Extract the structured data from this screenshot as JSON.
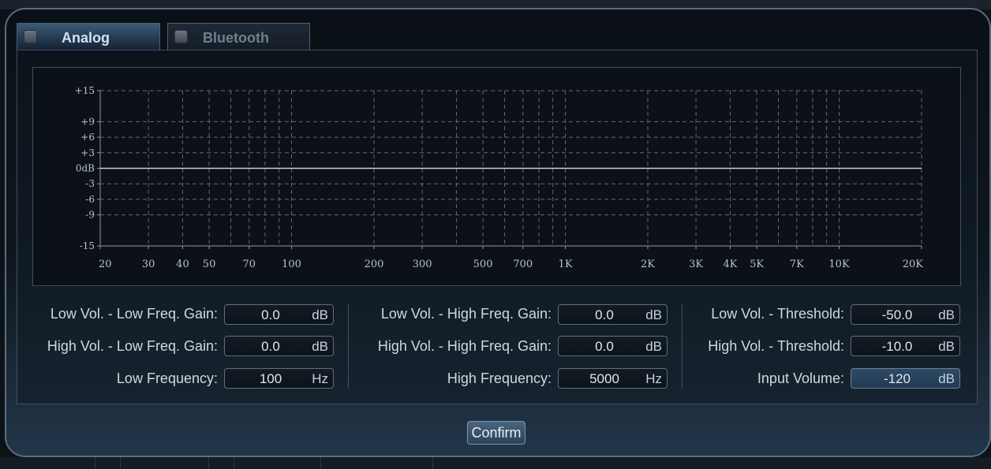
{
  "tabs": [
    {
      "label": "Analog",
      "active": true
    },
    {
      "label": "Bluetooth",
      "active": false
    }
  ],
  "chart_data": {
    "type": "line",
    "y_ticks": [
      "+15",
      "+9",
      "+6",
      "+3",
      "0dB",
      "-3",
      "-6",
      "-9",
      "-15"
    ],
    "y_tick_values": [
      15,
      9,
      6,
      3,
      0,
      -3,
      -6,
      -9,
      -15
    ],
    "ylim": [
      -15,
      15
    ],
    "x_ticks": [
      "20",
      "30",
      "40",
      "50",
      "70",
      "100",
      "200",
      "300",
      "500",
      "700",
      "1K",
      "2K",
      "3K",
      "4K",
      "5K",
      "7K",
      "10K",
      "20K"
    ],
    "x_tick_values": [
      20,
      30,
      40,
      50,
      70,
      100,
      200,
      300,
      500,
      700,
      1000,
      2000,
      3000,
      4000,
      5000,
      7000,
      10000,
      20000
    ],
    "x_grid_values": [
      20,
      30,
      40,
      50,
      60,
      70,
      80,
      90,
      100,
      200,
      300,
      400,
      500,
      600,
      700,
      800,
      900,
      1000,
      2000,
      3000,
      4000,
      5000,
      6000,
      7000,
      8000,
      9000,
      10000,
      20000
    ],
    "xlim": [
      20,
      20000
    ],
    "x_scale": "log",
    "grid": true,
    "series": [
      {
        "x": [
          20,
          20000
        ],
        "y": [
          0,
          0
        ]
      }
    ]
  },
  "fields": {
    "lv_low_gain": {
      "label": "Low Vol. - Low Freq. Gain:",
      "value": "0.0",
      "unit": "dB"
    },
    "hv_low_gain": {
      "label": "High Vol. - Low Freq. Gain:",
      "value": "0.0",
      "unit": "dB"
    },
    "low_freq": {
      "label": "Low Frequency:",
      "value": "100",
      "unit": "Hz"
    },
    "lv_high_gain": {
      "label": "Low Vol. - High Freq. Gain:",
      "value": "0.0",
      "unit": "dB"
    },
    "hv_high_gain": {
      "label": "High Vol. - High Freq. Gain:",
      "value": "0.0",
      "unit": "dB"
    },
    "high_freq": {
      "label": "High Frequency:",
      "value": "5000",
      "unit": "Hz"
    },
    "lv_threshold": {
      "label": "Low Vol. - Threshold:",
      "value": "-50.0",
      "unit": "dB"
    },
    "hv_threshold": {
      "label": "High Vol. - Threshold:",
      "value": "-10.0",
      "unit": "dB"
    },
    "input_volume": {
      "label": "Input Volume:",
      "value": "-120",
      "unit": "dB"
    }
  },
  "confirm_label": "Confirm"
}
